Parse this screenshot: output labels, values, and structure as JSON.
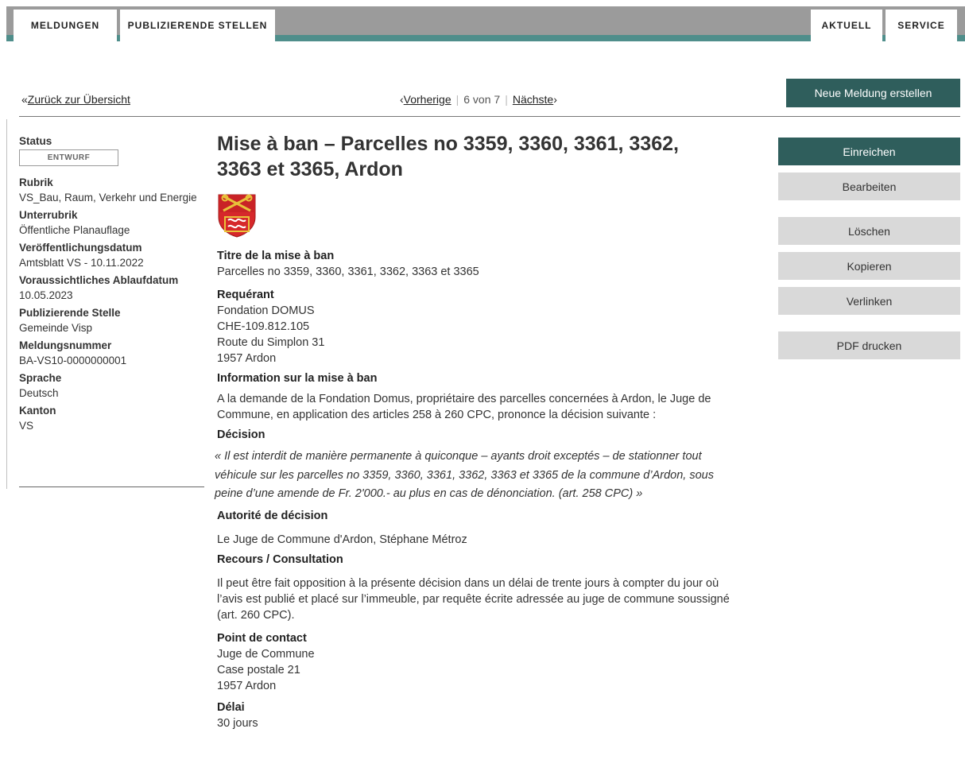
{
  "nav": {
    "tabs": [
      "MELDUNGEN",
      "PUBLIZIERENDE STELLEN"
    ],
    "right_tabs": [
      "AKTUELL",
      "SERVICE"
    ]
  },
  "toolbar": {
    "back_arrow": "«",
    "back_label": "Zurück zur Übersicht",
    "prev_label": "Vorherige",
    "prev_arrow": "‹",
    "position": "6 von 7",
    "next_label": "Nächste",
    "next_arrow": "›",
    "new_button": "Neue Meldung erstellen"
  },
  "sidebar": {
    "status_label": "Status",
    "status_value": "ENTWURF",
    "rubrik_label": "Rubrik",
    "rubrik_value": "VS_Bau, Raum, Verkehr und Energie",
    "unterrubrik_label": "Unterrubrik",
    "unterrubrik_value": "Öffentliche Planauflage",
    "pubdate_label": "Veröffentlichungsdatum",
    "pubdate_value": "Amtsblatt VS - 10.11.2022",
    "expiry_label": "Voraussichtliches Ablaufdatum",
    "expiry_value": "10.05.2023",
    "publisher_label": "Publizierende Stelle",
    "publisher_value": "Gemeinde Visp",
    "number_label": "Meldungsnummer",
    "number_value": "BA-VS10-0000000001",
    "language_label": "Sprache",
    "language_value": "Deutsch",
    "canton_label": "Kanton",
    "canton_value": "VS"
  },
  "main": {
    "title": "Mise à ban – Parcelles no 3359, 3360, 3361, 3362, 3363 et 3365, Ardon",
    "titre_label": "Titre de la mise à ban",
    "titre_value": "Parcelles no 3359, 3360, 3361, 3362, 3363 et 3365",
    "requerant_label": "Requérant",
    "requerant_lines": [
      "Fondation DOMUS",
      "CHE-109.812.105",
      "Route du Simplon 31",
      "1957 Ardon"
    ],
    "info_label": "Information sur la mise à ban",
    "info_text": "A la demande de la Fondation Domus, propriétaire des parcelles concernées à Ardon, le Juge de Commune, en application des articles 258 à 260 CPC, prononce la décision suivante :",
    "decision_label": "Décision",
    "decision_text": "« Il est interdit de manière permanente à quiconque – ayants droit exceptés – de stationner tout véhicule sur les parcelles no 3359, 3360, 3361, 3362, 3363 et 3365 de la commune d’Ardon, sous peine d’une amende de Fr. 2'000.- au plus en cas de dénonciation. (art. 258 CPC) »",
    "autorite_label": "Autorité de décision",
    "autorite_text": "Le Juge de Commune d'Ardon, Stéphane Métroz",
    "recours_label": "Recours / Consultation",
    "recours_text": "Il peut être fait opposition à la présente décision dans un délai de trente jours à compter du jour où l’avis est publié et placé sur l’immeuble, par requête écrite adressée au juge de commune soussigné (art. 260 CPC).",
    "contact_label": "Point de contact",
    "contact_lines": [
      "Juge de Commune",
      "Case postale 21",
      "1957 Ardon"
    ],
    "delai_label": "Délai",
    "delai_value": "30 jours"
  },
  "actions": {
    "submit": "Einreichen",
    "edit": "Bearbeiten",
    "delete": "Löschen",
    "copy": "Kopieren",
    "link": "Verlinken",
    "pdf": "PDF drucken"
  },
  "colors": {
    "accent": "#2f5e5c",
    "nav_teal": "#4f8e8b",
    "nav_grey": "#9b9b9b",
    "button_grey": "#d9d9d9",
    "coat_red": "#d6282b",
    "coat_gold": "#e8c23a"
  },
  "icons": {
    "coat_of_arms": "ardon-coat-of-arms-icon"
  }
}
